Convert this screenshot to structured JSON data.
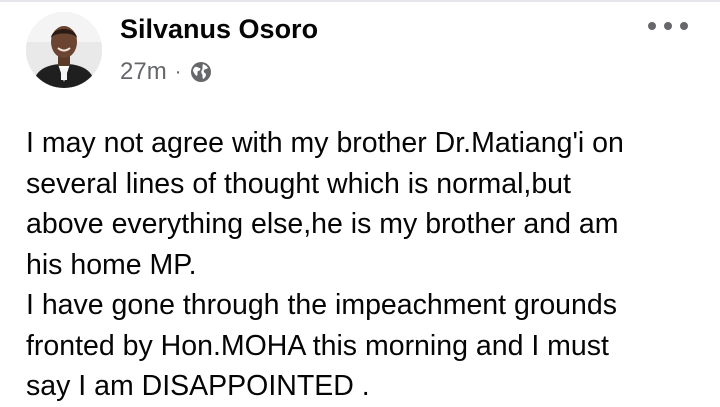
{
  "post": {
    "author": "Silvanus Osoro",
    "timestamp": "27m",
    "separator": "·",
    "privacy_icon": "globe-icon",
    "more_icon": "more-horizontal-icon",
    "paragraphs": [
      "I may not agree with my brother Dr.Matiang'i on\nseveral lines of thought which is normal,but\nabove everything else,he is my brother and am\nhis home MP.",
      "I have gone through the impeachment grounds\nfronted by Hon.MOHA this morning and I must\nsay I am DISAPPOINTED ."
    ]
  },
  "colors": {
    "text": "#050505",
    "secondary_text": "#65676b",
    "divider": "#e4e6eb"
  }
}
